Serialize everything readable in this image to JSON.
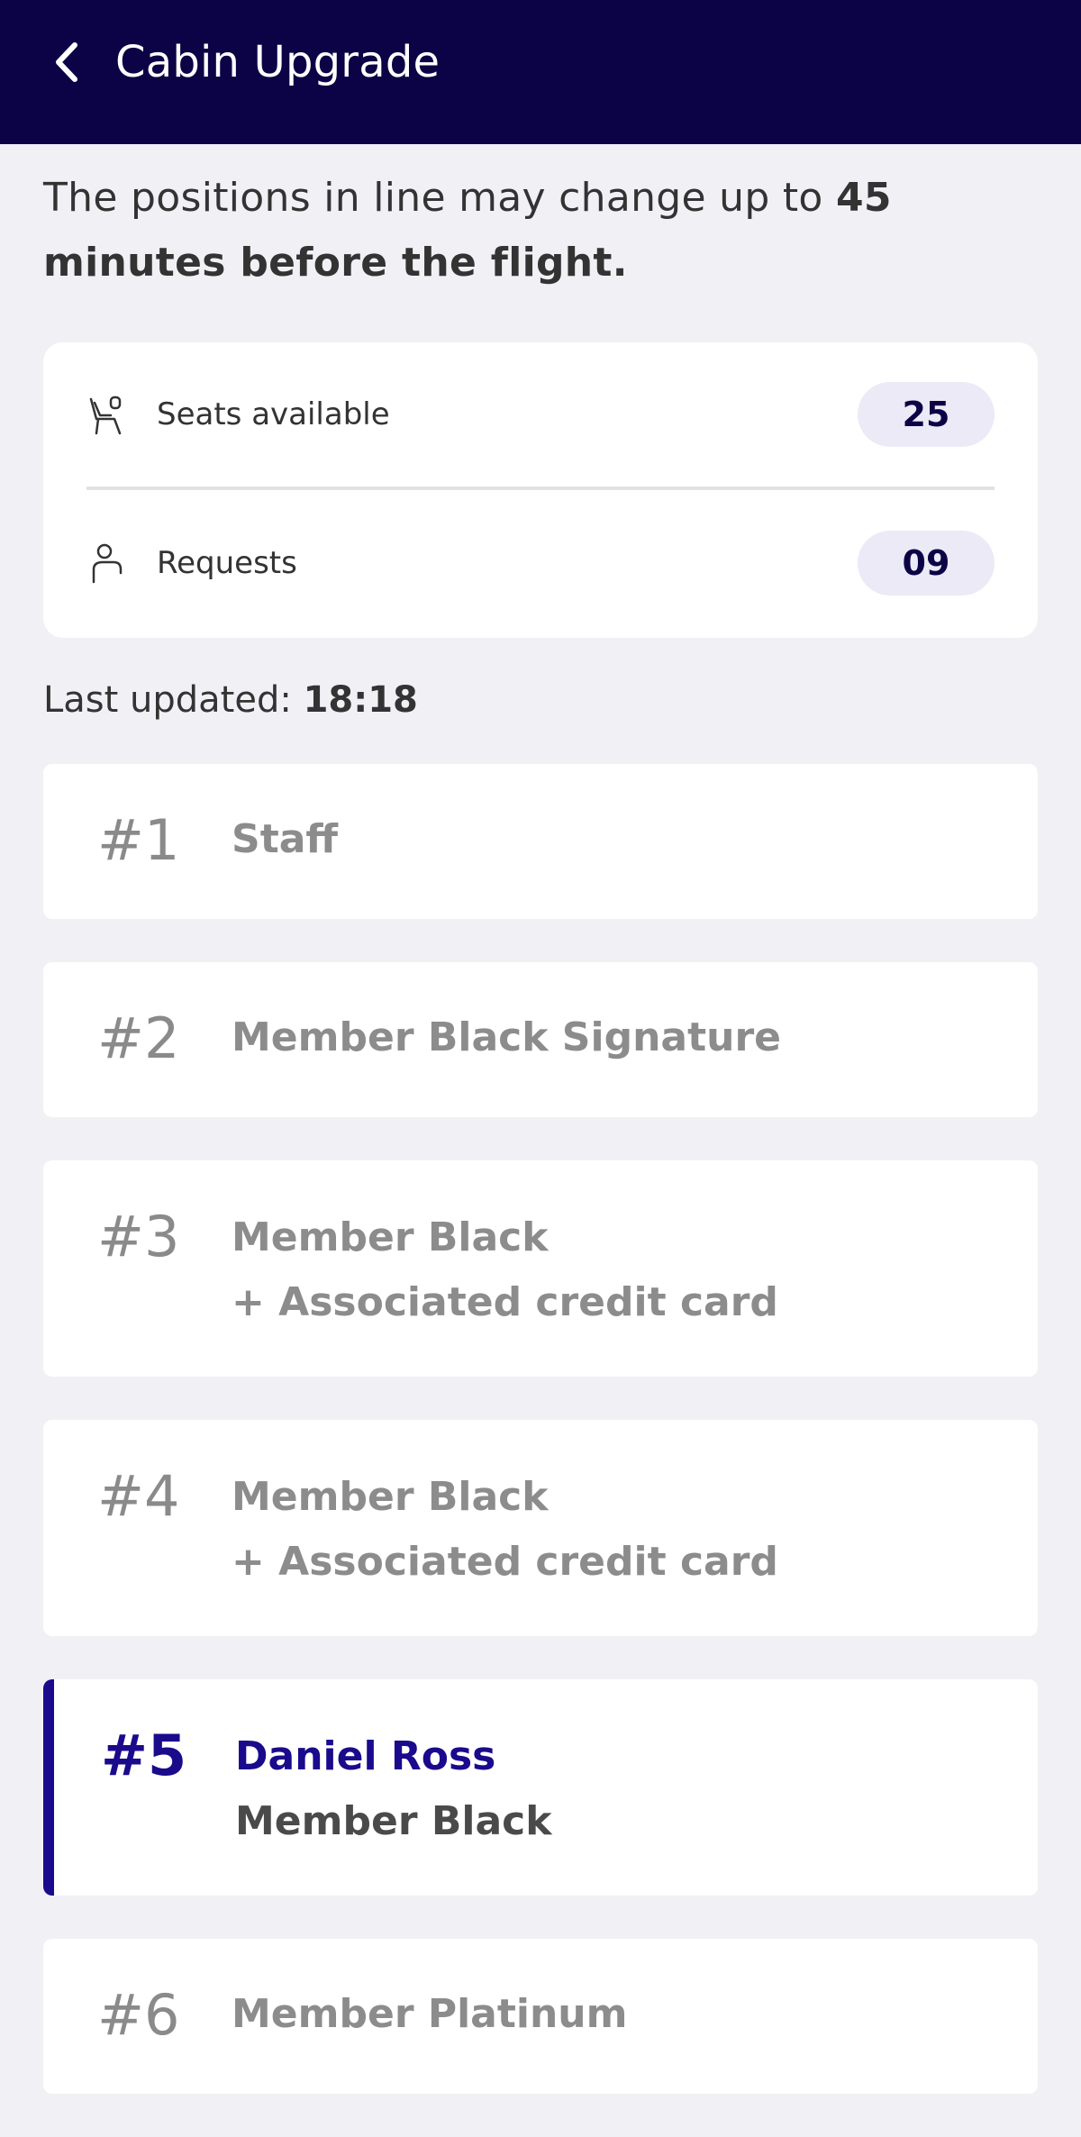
{
  "header": {
    "title": "Cabin Upgrade",
    "background": "#0c0346"
  },
  "info": {
    "text_prefix": "The positions in line may change up to ",
    "text_bold": "45 minutes before the flight."
  },
  "stats": {
    "seats_label": "Seats available",
    "seats_value": "25",
    "requests_label": "Requests",
    "requests_value": "09"
  },
  "last_updated": {
    "label": "Last updated: ",
    "time": "18:18"
  },
  "queue": [
    {
      "position": "#1",
      "line1": "Staff",
      "line2": ""
    },
    {
      "position": "#2",
      "line1": "Member Black Signature",
      "line2": ""
    },
    {
      "position": "#3",
      "line1": "Member Black",
      "line2": "+ Associated credit card"
    },
    {
      "position": "#4",
      "line1": "Member Black",
      "line2": "+ Associated credit card"
    },
    {
      "position": "#5",
      "line1": "Daniel Ross",
      "line2": "Member Black",
      "current": true
    },
    {
      "position": "#6",
      "line1": "Member Platinum",
      "line2": ""
    }
  ],
  "colors": {
    "accent": "#1a0a8c",
    "page_bg": "#f1f0f5",
    "badge_bg": "#ebeaf6"
  },
  "icons": {
    "back": "chevron-left-icon",
    "seat": "seat-icon",
    "person": "person-icon"
  }
}
